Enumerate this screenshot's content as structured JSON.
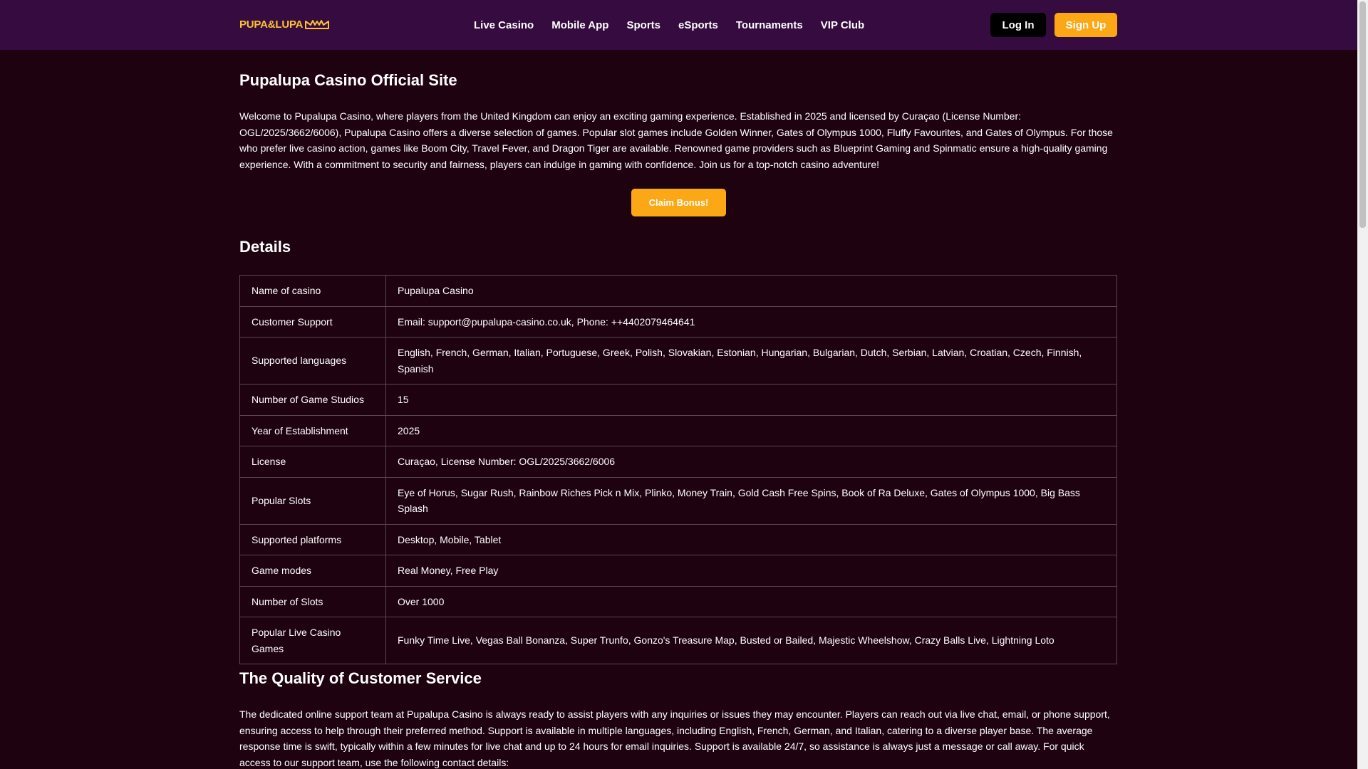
{
  "header": {
    "logo_text": "PUPA&LUPA",
    "nav": [
      "Live Casino",
      "Mobile App",
      "Sports",
      "eSports",
      "Tournaments",
      "VIP Club"
    ],
    "login_label": "Log In",
    "signup_label": "Sign Up"
  },
  "colors": {
    "background": "#1e020f",
    "header": "#360b3f",
    "accent": "#fca715",
    "logo": "#fdc230"
  },
  "main": {
    "title": "Pupalupa Casino Official Site",
    "intro": "Welcome to Pupalupa Casino, where players from the United Kingdom can enjoy an exciting gaming experience. Established in 2025 and licensed by Curaçao (License Number: OGL/2025/3662/6006), Pupalupa Casino offers a diverse selection of games. Popular slot games include Golden Winner, Gates of Olympus 1000, Fluffy Favourites, and Gates of Olympus. For those who prefer live casino action, games like Boom City, Travel Fever, and Dragon Tiger are available. Renowned game providers such as Blueprint Gaming and Spinmatic ensure a high-quality gaming experience. With a commitment to security and fairness, players can indulge in gaming with confidence. Join us for a top-notch casino adventure!",
    "claim_label": "Claim Bonus!",
    "details_heading": "Details",
    "details": [
      {
        "key": "Name of casino",
        "value": "Pupalupa Casino"
      },
      {
        "key": "Customer Support",
        "value": "Email: support@pupalupa-casino.co.uk, Phone: ++4402079464641"
      },
      {
        "key": "Supported languages",
        "value": "English, French, German, Italian, Portuguese, Greek, Polish, Slovakian, Estonian, Hungarian, Bulgarian, Dutch, Serbian, Latvian, Croatian, Czech, Finnish, Spanish"
      },
      {
        "key": "Number of Game Studios",
        "value": "15"
      },
      {
        "key": "Year of Establishment",
        "value": "2025"
      },
      {
        "key": "License",
        "value": "Curaçao, License Number: OGL/2025/3662/6006"
      },
      {
        "key": "Popular Slots",
        "value": "Eye of Horus, Sugar Rush, Rainbow Riches Pick n Mix, Plinko, Money Train, Gold Cash Free Spins, Book of Ra Deluxe, Gates of Olympus 1000, Big Bass Splash"
      },
      {
        "key": "Supported platforms",
        "value": "Desktop, Mobile, Tablet"
      },
      {
        "key": "Game modes",
        "value": "Real Money, Free Play"
      },
      {
        "key": "Number of Slots",
        "value": "Over 1000"
      },
      {
        "key": "Popular Live Casino Games",
        "value": "Funky Time Live, Vegas Ball Bonanza, Super Trunfo, Gonzo's Treasure Map, Busted or Bailed, Majestic Wheelshow, Crazy Balls Live, Lightning Loto"
      }
    ],
    "service_heading": "The Quality of Customer Service",
    "service_text": "The dedicated online support team at Pupalupa Casino is always ready to assist players with any inquiries or issues they may encounter. Players can reach out via live chat, email, or phone support, ensuring access to help through their preferred method. Support is available in multiple languages, including English, French, German, and Italian, catering to a diverse player base. The average response time is swift, typically within a few minutes for live chat and up to 24 hours for email inquiries. Support is available 24/7, so assistance is always just a message or call away. For quick access to our support team, use the following contact details:"
  }
}
